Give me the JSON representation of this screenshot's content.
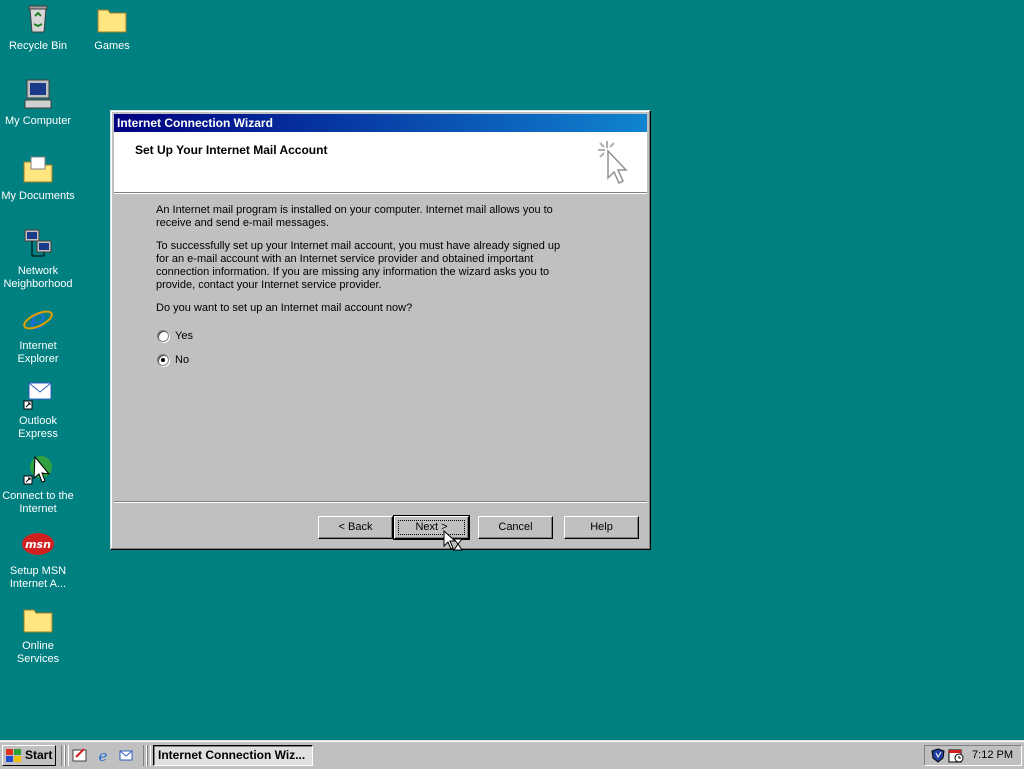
{
  "desktop": {
    "icons": [
      {
        "label": "Recycle Bin"
      },
      {
        "label": "Games"
      },
      {
        "label": "My Computer"
      },
      {
        "label": "My Documents"
      },
      {
        "label": "Network Neighborhood"
      },
      {
        "label": "Internet Explorer"
      },
      {
        "label": "Outlook Express"
      },
      {
        "label": "Connect to the Internet"
      },
      {
        "label": "Setup MSN Internet A..."
      },
      {
        "label": "Online Services"
      }
    ],
    "background_color": "#008080"
  },
  "window": {
    "title": "Internet Connection Wizard",
    "header_title": "Set Up Your Internet Mail Account",
    "paragraph1": "An Internet mail program is installed on your computer. Internet mail allows you to receive and send e-mail messages.",
    "paragraph2": "To successfully set up your Internet mail account, you must have already signed up for an e-mail account with an Internet service provider and obtained important connection information. If you are missing any information the wizard asks you to provide, contact your Internet service provider.",
    "question": "Do you want to set up an Internet mail account now?",
    "options": [
      {
        "label": "Yes",
        "checked": false
      },
      {
        "label": "No",
        "checked": true
      }
    ],
    "buttons": {
      "back": "< Back",
      "next": "Next >",
      "cancel": "Cancel",
      "help": "Help"
    }
  },
  "taskbar": {
    "start_label": "Start",
    "task_button": "Internet Connection Wiz...",
    "clock": "7:12 PM",
    "quick_launch": [
      "desktop-icon",
      "internet-explorer-icon",
      "outlook-express-icon"
    ]
  }
}
